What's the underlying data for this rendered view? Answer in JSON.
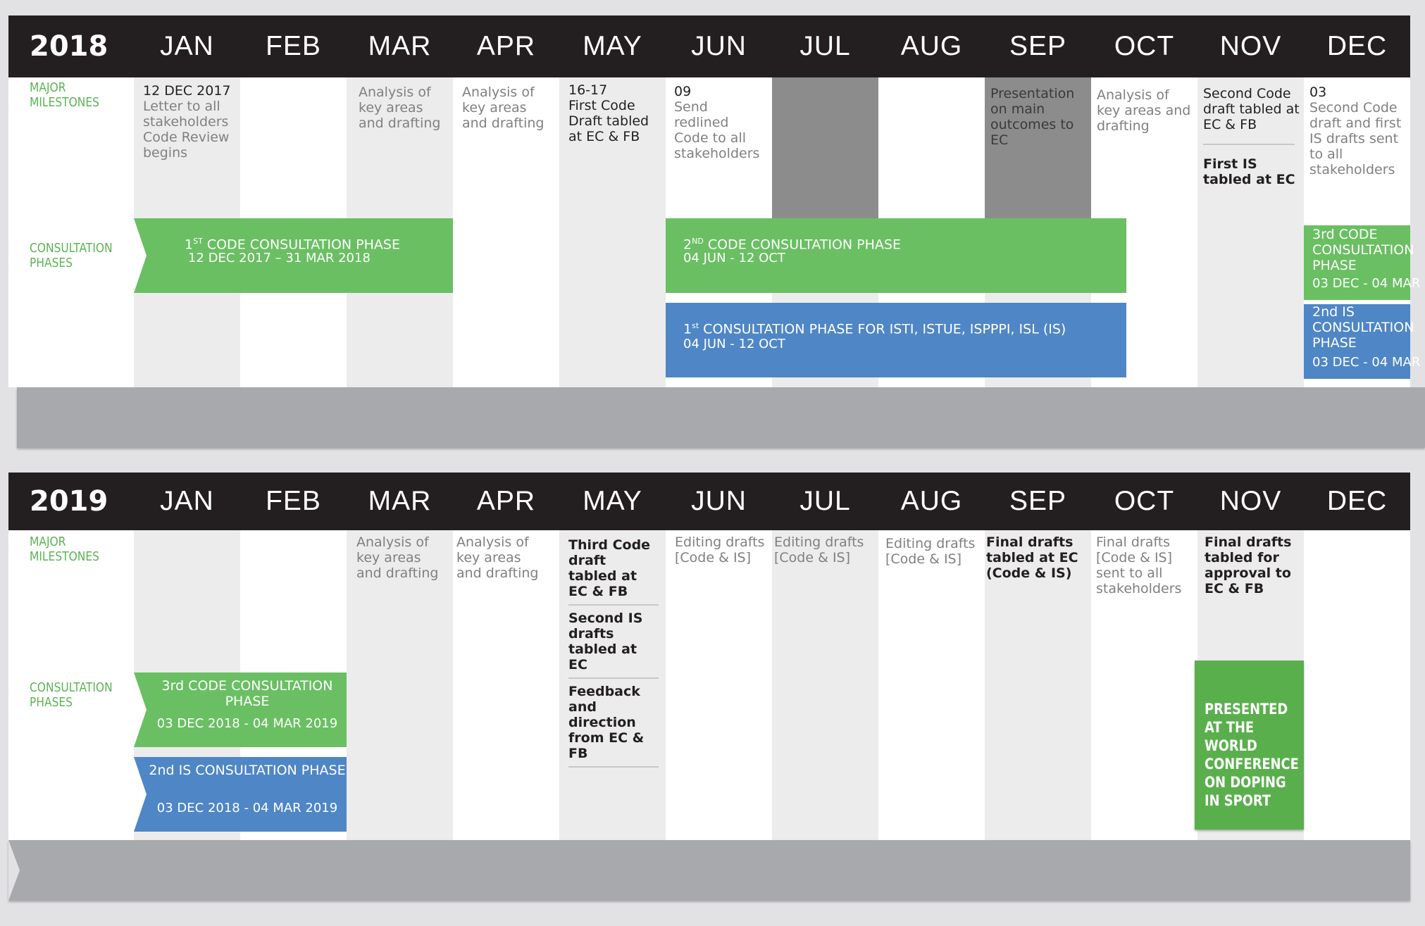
{
  "months": [
    "JAN",
    "FEB",
    "MAR",
    "APR",
    "MAY",
    "JUN",
    "JUL",
    "AUG",
    "SEP",
    "OCT",
    "NOV",
    "DEC"
  ],
  "labels": {
    "major_milestones": "MAJOR MILESTONES",
    "consultation_phases": "CONSULTATION PHASES"
  },
  "colors": {
    "header": "#231f20",
    "green": "#6abf63",
    "blue": "#4f86c6",
    "label_green": "#5ab552",
    "band": "#a7a9ac"
  },
  "y2018": {
    "year": "2018",
    "milestones": {
      "jan": {
        "date": "12 DEC 2017",
        "text": "Letter to all stakeholders Code Review begins"
      },
      "mar": "Analysis of key areas and drafting",
      "apr": "Analysis of key areas and drafting",
      "may": {
        "date": "16-17",
        "text": "First Code Draft tabled at EC & FB"
      },
      "jun": {
        "date": "09",
        "text": "Send redlined Code to all stakeholders"
      },
      "sep": "Presentation on main outcomes to EC",
      "oct": "Analysis of key areas and drafting",
      "nov": {
        "text1": "Second Code draft tabled at EC & FB",
        "text2": "First IS tabled at EC"
      },
      "dec": {
        "date": "03",
        "text": "Second Code draft and first IS drafts sent to all stakeholders"
      }
    },
    "phases": {
      "code1": {
        "ordinal": "1",
        "sup": "ST",
        "name": " CODE CONSULTATION PHASE",
        "dates": "12 DEC 2017 – 31 MAR 2018"
      },
      "code2": {
        "ordinal": "2",
        "sup": "ND",
        "name": " CODE CONSULTATION PHASE",
        "dates": "04 JUN - 12 OCT"
      },
      "is1": {
        "ordinal": "1",
        "sup": "st",
        "name": " CONSULTATION PHASE FOR ISTI, ISTUE, ISPPPI, ISL (IS)",
        "dates": "04 JUN - 12 OCT"
      },
      "code3": {
        "name": "3rd CODE CONSULTATION PHASE",
        "dates": "03 DEC - 04 MAR"
      },
      "is2": {
        "name": "2nd IS CONSULTATION PHASE",
        "dates": "03 DEC - 04 MAR"
      }
    }
  },
  "y2019": {
    "year": "2019",
    "milestones": {
      "mar": "Analysis of key areas and drafting",
      "apr": "Analysis of key areas and drafting",
      "may": [
        "Third Code draft tabled at EC & FB",
        "Second IS drafts tabled at EC",
        "Feedback and direction from EC & FB"
      ],
      "jun": "Editing drafts [Code & IS]",
      "jul": "Editing drafts [Code & IS]",
      "aug": "Editing drafts [Code & IS]",
      "sep": "Final drafts tabled at EC (Code & IS)",
      "oct": "Final drafts [Code & IS] sent to all stakeholders",
      "nov": "Final drafts tabled for approval to EC & FB"
    },
    "phases": {
      "code3": {
        "name": "3rd CODE CONSULTATION PHASE",
        "dates": "03 DEC 2018 - 04 MAR 2019"
      },
      "is2": {
        "name": "2nd IS CONSULTATION PHASE",
        "dates": "03 DEC 2018 - 04 MAR 2019"
      }
    },
    "conference": "PRESENTED AT THE WORLD CONFERENCE ON DOPING IN SPORT"
  }
}
